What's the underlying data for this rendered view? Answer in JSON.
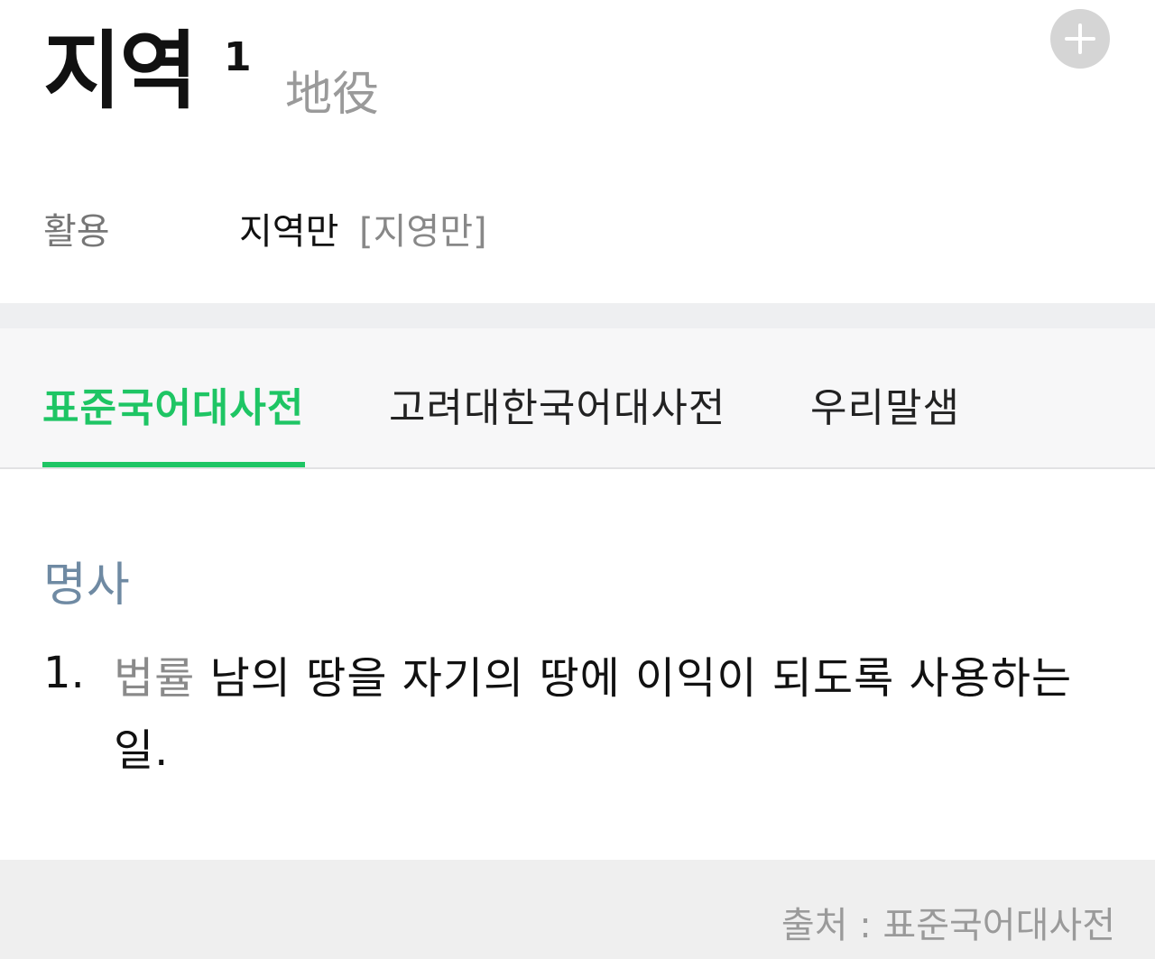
{
  "entry": {
    "headword": "지역",
    "homograph_number": "1",
    "hanja": "地役",
    "conjugation": {
      "label": "활용",
      "form": "지역만",
      "pronunciation": "[지영만]"
    },
    "add_icon": "plus-icon"
  },
  "tabs": [
    {
      "label": "표준국어대사전",
      "active": true
    },
    {
      "label": "고려대한국어대사전",
      "active": false
    },
    {
      "label": "우리말샘",
      "active": false
    }
  ],
  "content": {
    "part_of_speech": "명사",
    "definitions": [
      {
        "number": "1.",
        "category": "법률",
        "text": " 남의 땅을 자기의 땅에 이익이 되도록 사용하는 일."
      }
    ]
  },
  "footer": {
    "source": "출처 : 표준국어대사전"
  },
  "colors": {
    "accent": "#1ec564",
    "pos": "#6f8aa3",
    "muted": "#9a9a9a"
  }
}
